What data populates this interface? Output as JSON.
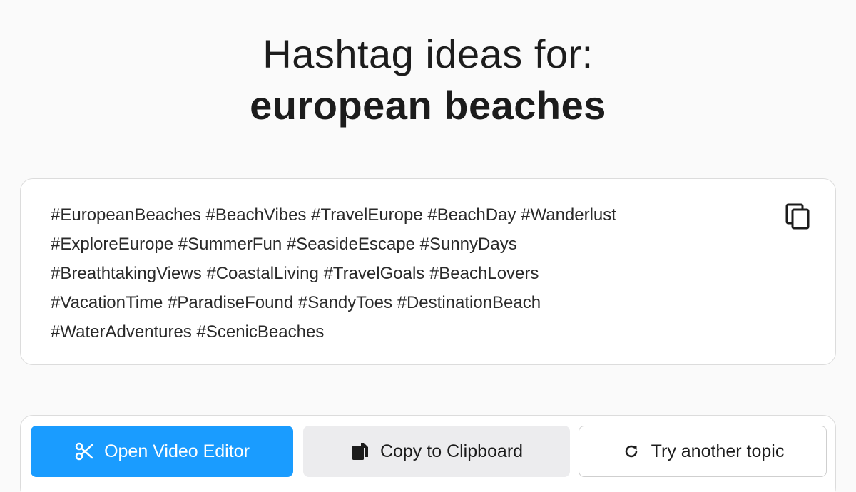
{
  "title": {
    "line1": "Hashtag ideas for:",
    "line2": "european beaches"
  },
  "result": {
    "hashtag_lines": [
      "#EuropeanBeaches #BeachVibes #TravelEurope #BeachDay #Wanderlust",
      "#ExploreEurope #SummerFun #SeasideEscape #SunnyDays",
      "#BreathtakingViews #CoastalLiving #TravelGoals #BeachLovers",
      "#VacationTime #ParadiseFound #SandyToes #DestinationBeach",
      "#WaterAdventures #ScenicBeaches"
    ],
    "copy_icon": "copy-icon"
  },
  "actions": {
    "open_video_editor": {
      "label": "Open Video Editor",
      "icon": "scissors-icon"
    },
    "copy_to_clipboard": {
      "label": "Copy to Clipboard",
      "icon": "clipboard-icon"
    },
    "try_another_topic": {
      "label": "Try another topic",
      "icon": "refresh-icon"
    }
  },
  "colors": {
    "primary": "#1a9cff",
    "secondary_bg": "#ececee",
    "page_bg": "#fafafa"
  }
}
